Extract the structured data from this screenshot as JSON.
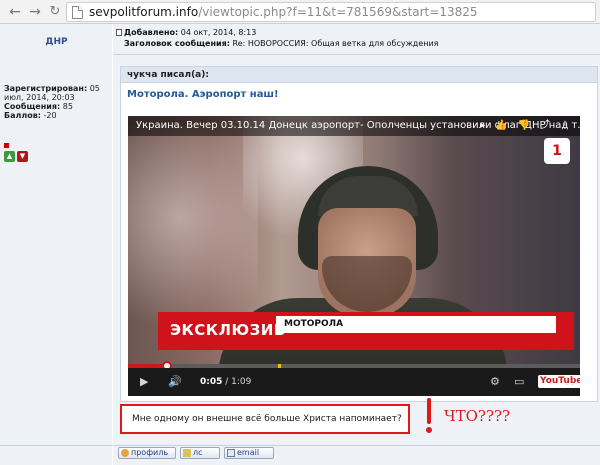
{
  "browser": {
    "url_host": "sevpolitforum.info",
    "url_path": "/viewtopic.php?f=11&t=781569&start=13825",
    "back_label": "←",
    "forward_label": "→",
    "reload_label": "↻"
  },
  "author": {
    "name": "ДНР",
    "registered_label": "Зарегистрирован:",
    "registered_value": "05 июл, 2014, 20:03",
    "messages_label": "Сообщения:",
    "messages_value": "85",
    "points_label": "Баллов:",
    "points_value": "-20"
  },
  "post": {
    "added_label": "Добавлено:",
    "added_value": "04 окт, 2014, 8:13",
    "subject_label": "Заголовок сообщения:",
    "subject_value": "Re: НОВОРОССИЯ: Общая ветка для обсуждения"
  },
  "quote": {
    "title": "чукча писал(а):",
    "text": "Моторола. Аэропорт наш!"
  },
  "video": {
    "title": "Украина. Вечер 03.10.14 Донецк аэропорт- Ополченцы установили флаг ДНР над т...",
    "exclusive_text": "ЭКСКЛЮЗИВ",
    "name_plate": "МОТОРОЛА",
    "time_current": "0:05",
    "time_total": "1:09",
    "logo_text": "YouTube",
    "channel_logo": "1",
    "actions": [
      "▸",
      "👍",
      "👎",
      "⤴",
      "⋮"
    ]
  },
  "reply": {
    "text": "Мне одному он внешне всё больше Христа напоминает?"
  },
  "annotation": {
    "text": "ЧТО????"
  },
  "buttons": {
    "profile": "профиль",
    "pm": "лс",
    "email": "email"
  }
}
